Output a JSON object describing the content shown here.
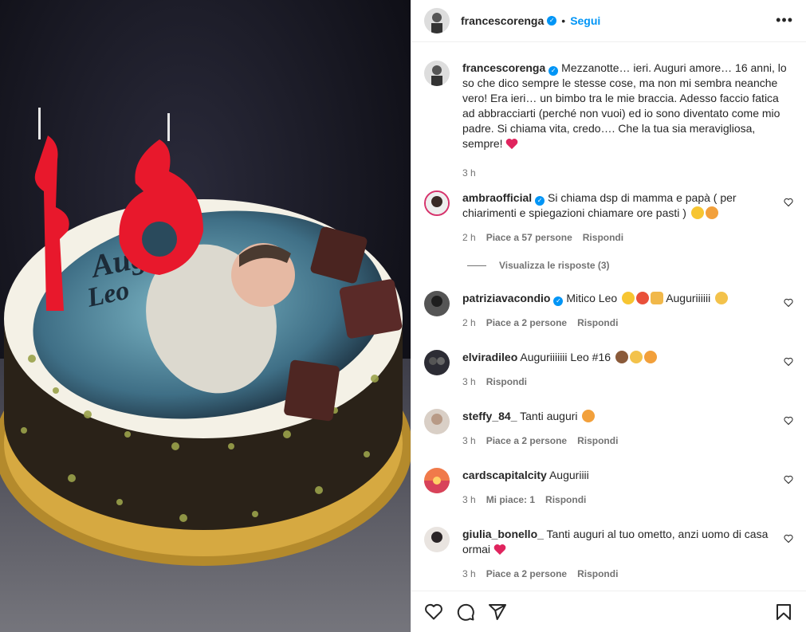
{
  "post": {
    "author": "francescorenga",
    "follow_label": "Segui",
    "separator": "•",
    "more_label": "•••",
    "verified_mark": "✓",
    "media_description_icon": "birthday-cake-photo",
    "cake_text_1": "Auguri",
    "cake_text_2": "Leo",
    "caption": {
      "username": "francescorenga",
      "text": "Mezzanotte… ieri. Auguri amore… 16 anni, lo so che dico sempre le stesse cose, ma non mi sembra neanche vero! Era ieri… un bimbo tra le mie braccia. Adesso faccio fatica ad abbracciarti (perché non vuoi) ed io sono diventato come mio padre. Si chiama vita, credo…. Che la tua sia meravigliosa, sempre!",
      "time": "3 h"
    }
  },
  "comments": [
    {
      "username": "ambraofficial",
      "verified": true,
      "text": "Si chiama dsp di mamma e papà ( per chiarimenti e spiegazioni chiamare ore pasti )",
      "time": "2 h",
      "likes": "Piace a 57 persone",
      "reply": "Rispondi",
      "avatar_color": "#3a2a26"
    },
    {
      "username": "patriziavacondio",
      "verified": true,
      "text": "Mitico Leo",
      "text2": "Auguriiiiii",
      "time": "2 h",
      "likes": "Piace a 2 persone",
      "reply": "Rispondi",
      "avatar_color": "#1e1e1e"
    },
    {
      "username": "elviradileo",
      "verified": false,
      "text": "Auguriiiiiii Leo #16",
      "time": "3 h",
      "likes": "",
      "reply": "Rispondi",
      "avatar_color": "#2c2c34"
    },
    {
      "username": "steffy_84_",
      "verified": false,
      "text": "Tanti auguri",
      "time": "3 h",
      "likes": "Piace a 2 persone",
      "reply": "Rispondi",
      "avatar_color": "#b89a86"
    },
    {
      "username": "cardscapitalcity",
      "verified": false,
      "text": "Auguriiii",
      "time": "3 h",
      "likes": "Mi piace: 1",
      "reply": "Rispondi",
      "avatar_color": "#d8425a"
    },
    {
      "username": "giulia_bonello_",
      "verified": false,
      "text": "Tanti auguri al tuo ometto, anzi uomo di casa ormai",
      "time": "3 h",
      "likes": "Piace a 2 persone",
      "reply": "Rispondi",
      "avatar_color": "#2a2426"
    }
  ],
  "view_replies": "Visualizza le risposte (3)",
  "actions": {
    "like_icon": "heart-icon",
    "comment_icon": "comment-icon",
    "share_icon": "share-icon",
    "save_icon": "bookmark-icon"
  },
  "colors": {
    "accent": "#0095f6",
    "heart_red": "#e0245e",
    "candle_red": "#e8182c"
  }
}
